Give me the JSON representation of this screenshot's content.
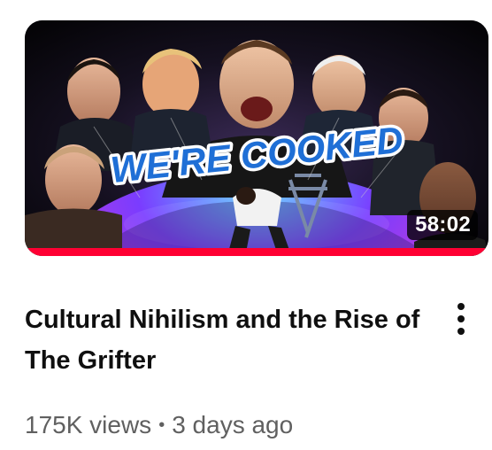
{
  "video": {
    "title": "Cultural Nihilism and the Rise of The Grifter",
    "duration": "58:02",
    "views": "175K views",
    "separator": "•",
    "age": "3 days ago",
    "watch_progress": 1.0,
    "progress_color": "#ff0033",
    "thumbnail": {
      "overlay_text": "WE'RE COOKED",
      "text_color": "#1f6fd6",
      "description_icon": "video-thumbnail-image"
    }
  },
  "menu": {
    "icon": "more-vert-icon"
  }
}
